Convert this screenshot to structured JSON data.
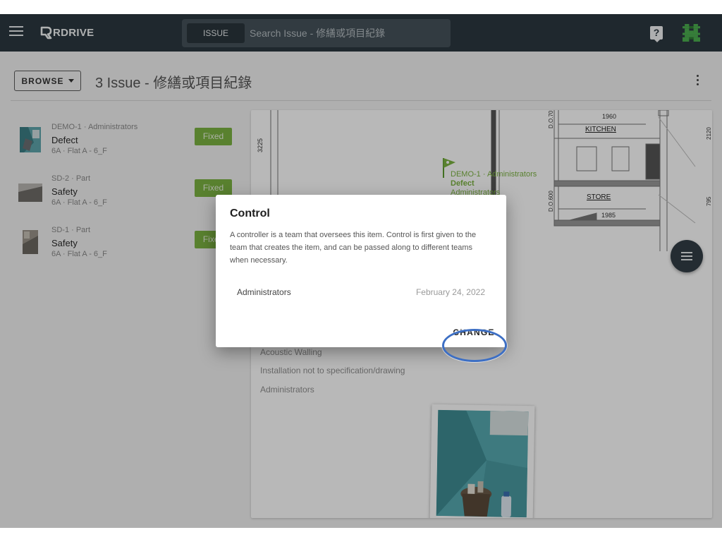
{
  "app": {
    "brand": "RDRIVE",
    "search_chip": "ISSUE",
    "search_placeholder": "Search Issue - 修繕或項目紀錄"
  },
  "header": {
    "browse_label": "BROWSE",
    "title": "3 Issue - 修繕或項目紀錄"
  },
  "issues": [
    {
      "meta": "DEMO-1 · Administrators",
      "name": "Defect",
      "location": "6A · Flat A - 6_F",
      "status": "Fixed"
    },
    {
      "meta": "SD-2 · Part",
      "name": "Safety",
      "location": "6A · Flat A - 6_F",
      "status": "Fixed"
    },
    {
      "meta": "SD-1 · Part",
      "name": "Safety",
      "location": "6A · Flat A - 6_F",
      "status": "Fixed"
    }
  ],
  "plan": {
    "dim_3225": "3225",
    "dim_1960": "1960",
    "dim_1985": "1985",
    "dim_2120": "2120",
    "dim_795": "795",
    "door_1": "D.O.70",
    "door_2": "D.O.600",
    "room_kitchen": "KITCHEN",
    "room_store": "STORE",
    "pin_meta": "DEMO-1 · Administrators",
    "pin_name": "Defect",
    "pin_team": "Administrators"
  },
  "detail": {
    "category": "Acoustic Walling",
    "description": "Installation not to specification/drawing",
    "team": "Administrators"
  },
  "dialog": {
    "title": "Control",
    "body": "A controller is a team that oversees this item. Control is first given to the team that creates the item, and can be passed along to different teams when necessary.",
    "team": "Administrators",
    "date": "February 24, 2022",
    "change_label": "CHANGE"
  },
  "colors": {
    "appbar": "#2c3840",
    "status_fixed": "#7cb342",
    "highlight": "#3d6fc4"
  }
}
